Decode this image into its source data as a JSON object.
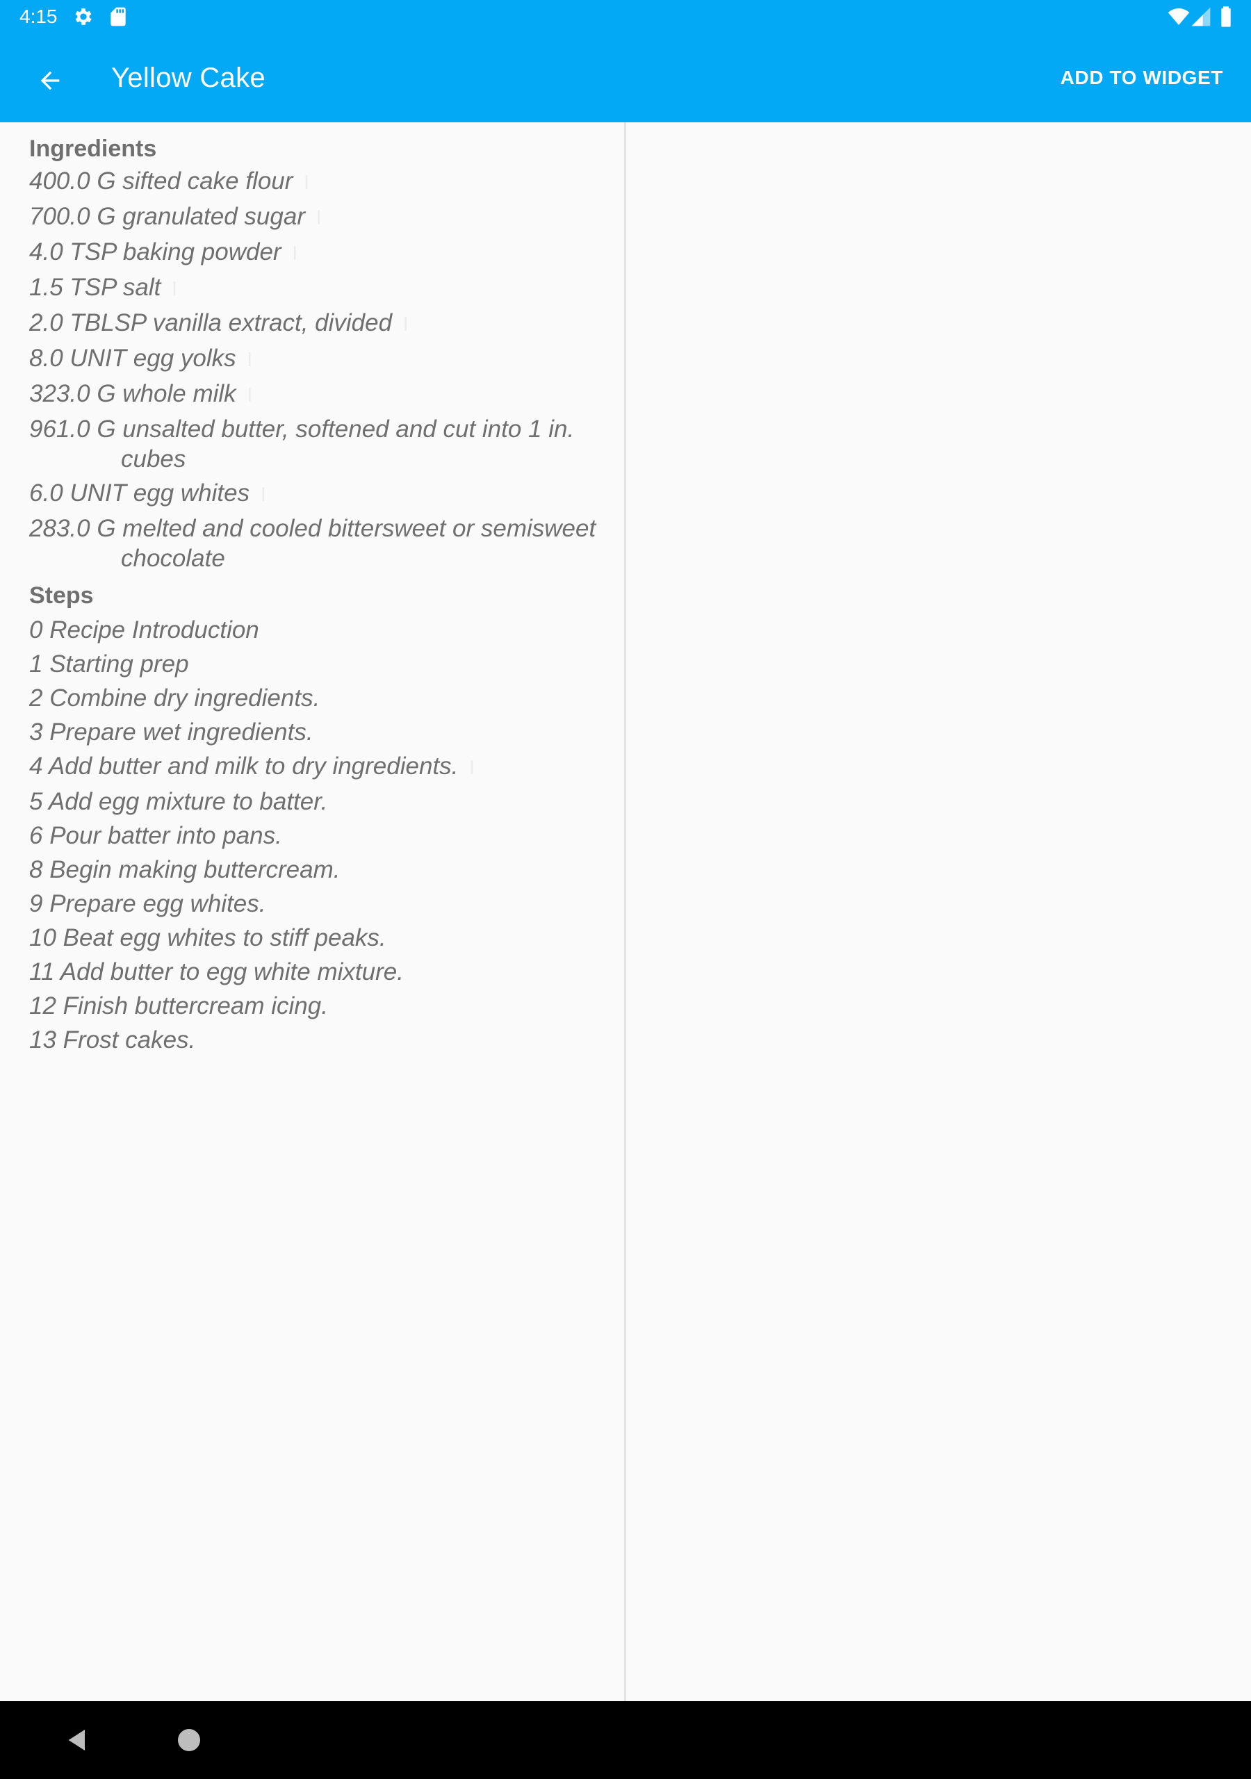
{
  "status_bar": {
    "time": "4:15",
    "icons": [
      "gear-icon",
      "sd-card-icon",
      "wifi-icon",
      "cell-signal-icon",
      "battery-icon"
    ]
  },
  "toolbar": {
    "back_icon": "arrow-left-icon",
    "title": "Yellow Cake",
    "action_label": "ADD TO WIDGET",
    "background_color": "#03a9f4"
  },
  "ingredients": {
    "header": "Ingredients",
    "items": [
      {
        "quantity": "400.0",
        "measure": "G",
        "name": "sifted cake flour"
      },
      {
        "quantity": "700.0",
        "measure": "G",
        "name": "granulated sugar"
      },
      {
        "quantity": "4.0",
        "measure": "TSP",
        "name": "baking powder"
      },
      {
        "quantity": "1.5",
        "measure": "TSP",
        "name": "salt"
      },
      {
        "quantity": "2.0",
        "measure": "TBLSP",
        "name": "vanilla extract, divided"
      },
      {
        "quantity": "8.0",
        "measure": "UNIT",
        "name": "egg yolks"
      },
      {
        "quantity": "323.0",
        "measure": "G",
        "name": "whole milk"
      },
      {
        "quantity": "961.0",
        "measure": "G",
        "name": "unsalted butter, softened and cut into 1 in. cubes"
      },
      {
        "quantity": "6.0",
        "measure": "UNIT",
        "name": "egg whites"
      },
      {
        "quantity": "283.0",
        "measure": "G",
        "name": "melted and cooled bittersweet or semisweet chocolate"
      }
    ]
  },
  "steps": {
    "header": "Steps",
    "items": [
      {
        "number": "0",
        "label": "Recipe Introduction"
      },
      {
        "number": "1",
        "label": "Starting prep"
      },
      {
        "number": "2",
        "label": "Combine dry ingredients."
      },
      {
        "number": "3",
        "label": "Prepare wet ingredients."
      },
      {
        "number": "4",
        "label": "Add butter and milk to dry ingredients."
      },
      {
        "number": "5",
        "label": "Add egg mixture to batter."
      },
      {
        "number": "6",
        "label": "Pour batter into pans."
      },
      {
        "number": "8",
        "label": "Begin making buttercream."
      },
      {
        "number": "9",
        "label": "Prepare egg whites."
      },
      {
        "number": "10",
        "label": "Beat egg whites to stiff peaks."
      },
      {
        "number": "11",
        "label": "Add butter to egg white mixture."
      },
      {
        "number": "12",
        "label": "Finish buttercream icing."
      },
      {
        "number": "13",
        "label": "Frost cakes."
      }
    ]
  },
  "nav_bar": {
    "icons": [
      "nav-back-icon",
      "nav-home-icon"
    ]
  }
}
